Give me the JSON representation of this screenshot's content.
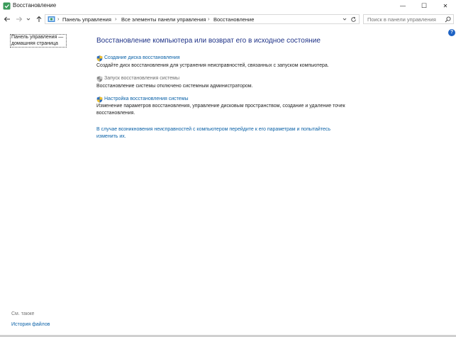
{
  "window": {
    "title": "Восстановление",
    "minimize_glyph": "—",
    "maximize_glyph": "☐",
    "close_glyph": "✕"
  },
  "address": {
    "breadcrumbs": [
      "Панель управления",
      "Все элементы панели управления",
      "Восстановление"
    ],
    "search_placeholder": "Поиск в панели управления"
  },
  "sidebar": {
    "home_link": "Панель управления — домашняя страница",
    "see_also": "См. также",
    "file_history": "История файлов"
  },
  "main": {
    "heading": "Восстановление компьютера или возврат его в исходное состояние",
    "tasks": [
      {
        "label": "Создание диска восстановления",
        "description": "Создайте диск восстановления для устранения неисправностей, связанных с запуском компьютера.",
        "enabled": true
      },
      {
        "label": "Запуск восстановления системы",
        "description": "Восстановление системы отключено системным администратором.",
        "enabled": false
      },
      {
        "label": "Настройка восстановления системы",
        "description": "Изменение параметров восстановления, управление дисковым пространством, создание и удаление точек восстановления.",
        "enabled": true
      }
    ],
    "bottom_link": "В случае возникновения неисправностей с компьютером перейдите к его параметрам и попытайтесь изменить их."
  },
  "help_glyph": "?",
  "colors": {
    "link": "#0b62a8",
    "heading": "#1e3287",
    "help_badge": "#1d62c4"
  }
}
